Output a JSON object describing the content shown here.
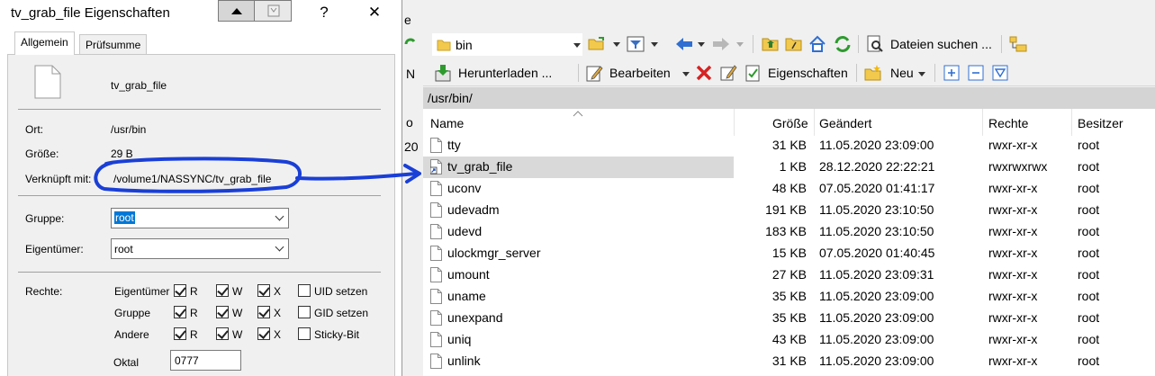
{
  "file_manager": {
    "edge_chars": [
      "e",
      "N",
      "o",
      "20"
    ],
    "path_combo": {
      "value": "bin"
    },
    "toolbar1": {
      "search_label": "Dateien suchen ..."
    },
    "toolbar2": {
      "download_label": "Herunterladen ...",
      "edit_label": "Bearbeiten",
      "properties_label": "Eigenschaften",
      "new_label": "Neu"
    },
    "path_bar": "/usr/bin/",
    "columns": {
      "name": "Name",
      "size": "Größe",
      "modified": "Geändert",
      "rights": "Rechte",
      "owner": "Besitzer"
    },
    "rows": [
      {
        "name": "tty",
        "size": "31 KB",
        "modified": "11.05.2020 23:09:00",
        "rights": "rwxr-xr-x",
        "owner": "root"
      },
      {
        "name": "tv_grab_file",
        "size": "1 KB",
        "modified": "28.12.2020 22:22:21",
        "rights": "rwxrwxrwx",
        "owner": "root",
        "selected": true,
        "link": true
      },
      {
        "name": "uconv",
        "size": "48 KB",
        "modified": "07.05.2020 01:41:17",
        "rights": "rwxr-xr-x",
        "owner": "root"
      },
      {
        "name": "udevadm",
        "size": "191 KB",
        "modified": "11.05.2020 23:10:50",
        "rights": "rwxr-xr-x",
        "owner": "root"
      },
      {
        "name": "udevd",
        "size": "183 KB",
        "modified": "11.05.2020 23:10:50",
        "rights": "rwxr-xr-x",
        "owner": "root"
      },
      {
        "name": "ulockmgr_server",
        "size": "15 KB",
        "modified": "07.05.2020 01:40:45",
        "rights": "rwxr-xr-x",
        "owner": "root"
      },
      {
        "name": "umount",
        "size": "27 KB",
        "modified": "11.05.2020 23:09:31",
        "rights": "rwxr-xr-x",
        "owner": "root"
      },
      {
        "name": "uname",
        "size": "35 KB",
        "modified": "11.05.2020 23:09:00",
        "rights": "rwxr-xr-x",
        "owner": "root"
      },
      {
        "name": "unexpand",
        "size": "35 KB",
        "modified": "11.05.2020 23:09:00",
        "rights": "rwxr-xr-x",
        "owner": "root"
      },
      {
        "name": "uniq",
        "size": "43 KB",
        "modified": "11.05.2020 23:09:00",
        "rights": "rwxr-xr-x",
        "owner": "root"
      },
      {
        "name": "unlink",
        "size": "31 KB",
        "modified": "11.05.2020 23:09:00",
        "rights": "rwxr-xr-x",
        "owner": "root"
      }
    ]
  },
  "dialog": {
    "title": "tv_grab_file Eigenschaften",
    "title_buttons": {
      "help": "?",
      "close": "✕"
    },
    "tabs": [
      "Allgemein",
      "Prüfsumme"
    ],
    "file_name": "tv_grab_file",
    "location_label": "Ort:",
    "location_value": "/usr/bin",
    "size_label": "Größe:",
    "size_value": "29 B",
    "linked_label": "Verknüpft mit:",
    "linked_value": "/volume1/NASSYNC/tv_grab_file",
    "group_label": "Gruppe:",
    "group_value": "root",
    "owner_label": "Eigentümer:",
    "owner_value": "root",
    "rights_label": "Rechte:",
    "perm_rows": [
      "Eigentümer",
      "Gruppe",
      "Andere"
    ],
    "perm_cols": [
      "R",
      "W",
      "X"
    ],
    "extras": [
      "UID setzen",
      "GID setzen",
      "Sticky-Bit"
    ],
    "octal_label": "Oktal",
    "octal_value": "0777"
  },
  "annotation_color": "#1a3fd6"
}
